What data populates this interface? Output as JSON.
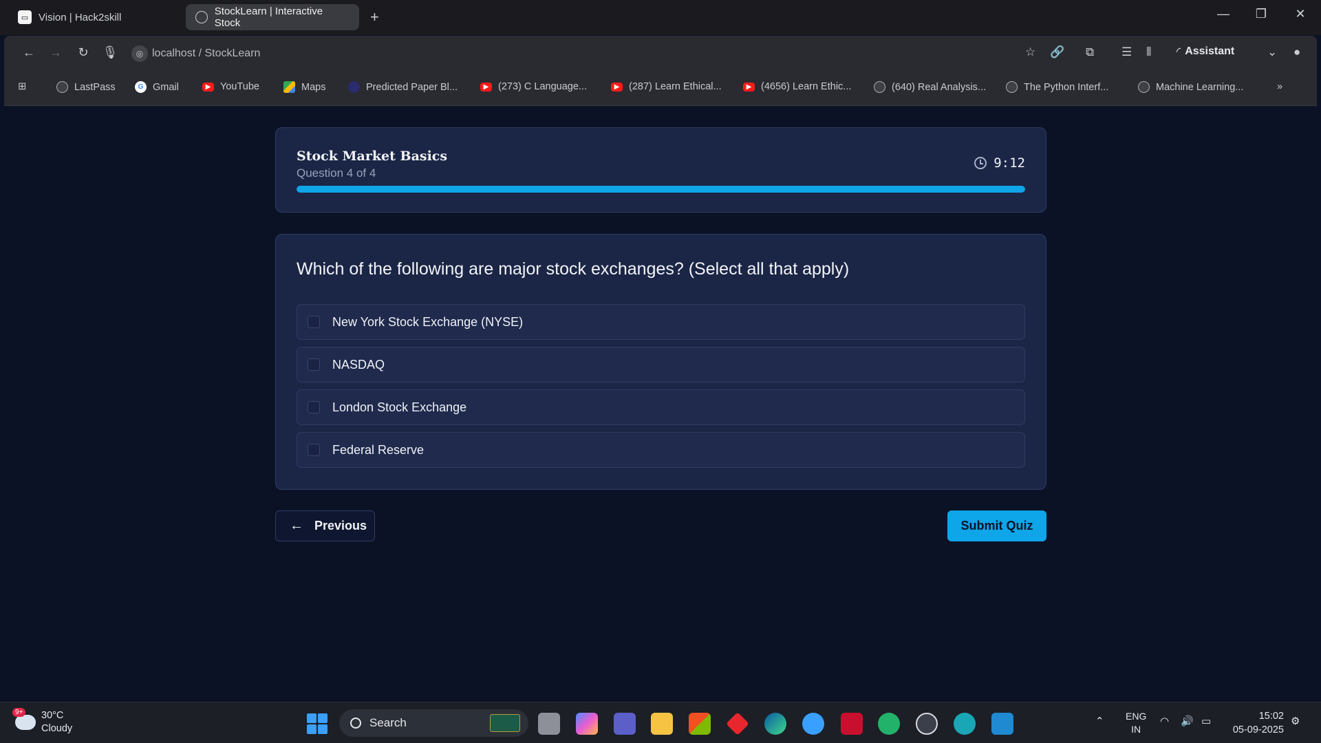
{
  "browser": {
    "tabs": [
      {
        "label": "Vision | Hack2skill",
        "active": false
      },
      {
        "label": "StockLearn | Interactive Stock",
        "active": true
      }
    ],
    "address": "localhost / StockLearn",
    "assistant_label": "Assistant",
    "bookmarks": [
      {
        "label": "LastPass",
        "icon": "globe"
      },
      {
        "label": "Gmail",
        "icon": "google"
      },
      {
        "label": "YouTube",
        "icon": "youtube"
      },
      {
        "label": "Maps",
        "icon": "maps"
      },
      {
        "label": "Predicted Paper Bl...",
        "icon": "dot"
      },
      {
        "label": "(273) C Language...",
        "icon": "youtube"
      },
      {
        "label": "(287) Learn Ethical...",
        "icon": "youtube"
      },
      {
        "label": "(4656) Learn Ethic...",
        "icon": "youtube"
      },
      {
        "label": "(640) Real Analysis...",
        "icon": "globe"
      },
      {
        "label": "The Python Interf...",
        "icon": "globe"
      },
      {
        "label": "Machine Learning...",
        "icon": "globe"
      }
    ]
  },
  "quiz": {
    "title": "Stock Market Basics",
    "progress_text": "Question 4 of 4",
    "timer": "9:12",
    "progress_fraction": 1.0,
    "progress_color": "#0ea5e9",
    "question": "Which of the following are major stock exchanges? (Select all that apply)",
    "options": [
      {
        "label": "New York Stock Exchange (NYSE)",
        "checked": false
      },
      {
        "label": "NASDAQ",
        "checked": false
      },
      {
        "label": "London Stock Exchange",
        "checked": false
      },
      {
        "label": "Federal Reserve",
        "checked": false
      }
    ],
    "previous_label": "Previous",
    "submit_label": "Submit Quiz"
  },
  "taskbar": {
    "weather_temp": "30°C",
    "weather_desc": "Cloudy",
    "weather_badge": "9+",
    "search_label": "Search",
    "lang": "ENG",
    "region": "IN",
    "time": "15:02",
    "date": "05-09-2025"
  }
}
